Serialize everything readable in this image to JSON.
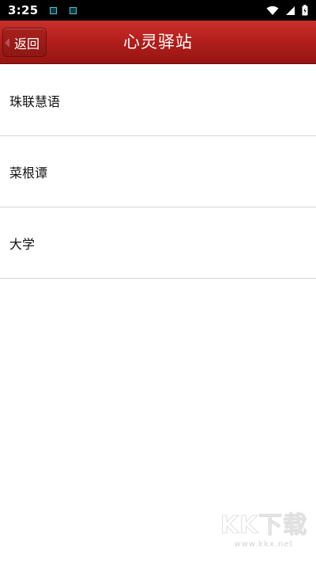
{
  "status_bar": {
    "time": "3:25",
    "icons": [
      "notification-icon",
      "notification-icon",
      "wifi-icon",
      "signal-icon",
      "battery-icon"
    ]
  },
  "header": {
    "back_label": "返回",
    "title": "心灵驿站",
    "color": "#b41f1c"
  },
  "list": {
    "items": [
      {
        "label": "珠联慧语"
      },
      {
        "label": "菜根谭"
      },
      {
        "label": "大学"
      }
    ]
  },
  "watermark": {
    "logo": "KK下载",
    "url": "www.kkx.net"
  }
}
